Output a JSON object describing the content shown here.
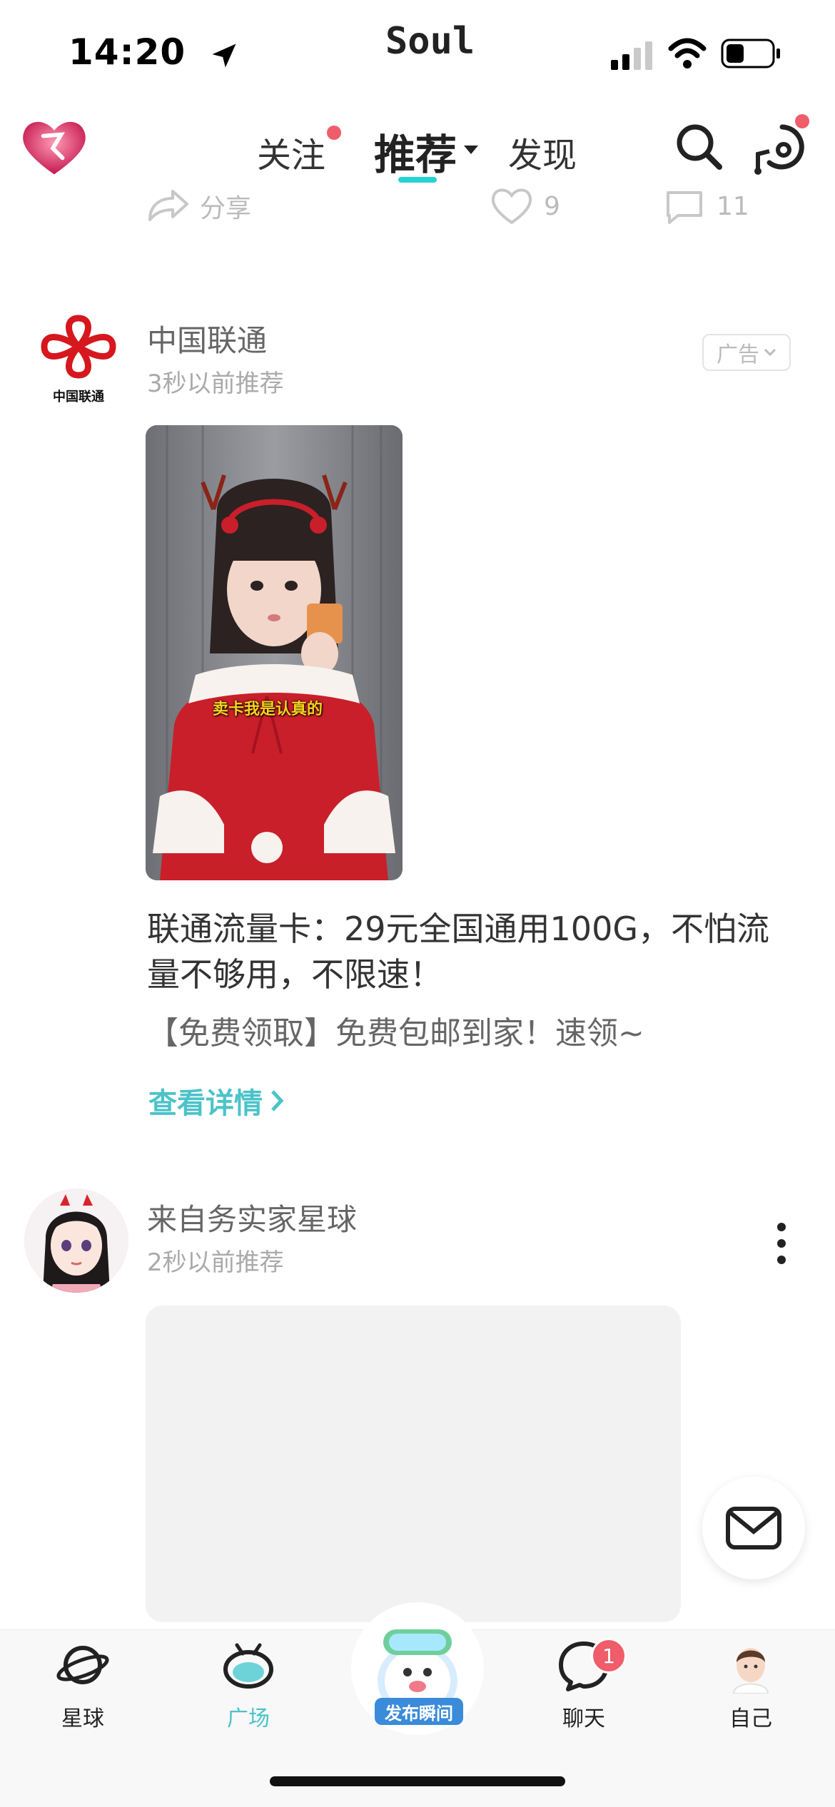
{
  "status_bar": {
    "time": "14:20",
    "app_name": "Soul",
    "battery_level": 0.4
  },
  "top_nav": {
    "tabs": [
      {
        "label": "关注",
        "has_dot": true
      },
      {
        "label": "推荐",
        "active": true
      },
      {
        "label": "发现"
      }
    ],
    "accent_color": "#25d4d0",
    "dot_color": "#ef5d6a",
    "icons": [
      "search-icon",
      "music-chat-icon"
    ]
  },
  "prev_post_actions": {
    "share_label": "分享",
    "like_count": "9",
    "comment_count": "11"
  },
  "ad_post": {
    "author": "中国联通",
    "logo_caption": "中国联通",
    "time": "3秒以前推荐",
    "badge": "广告",
    "image_caption": "卖卡我是认真的",
    "text": "联通流量卡：29元全国通用100G，不怕流量不够用，不限速！",
    "subtext": "【免费领取】免费包邮到家！速领~",
    "link": "查看详情"
  },
  "post2": {
    "author": "来自务实家星球",
    "time": "2秒以前推荐"
  },
  "bottom_tabs": {
    "items": [
      {
        "label": "星球"
      },
      {
        "label": "广场",
        "active": true
      },
      {
        "label": "发布瞬间"
      },
      {
        "label": "聊天",
        "badge": "1"
      },
      {
        "label": "自己"
      }
    ],
    "active_color": "#4bc3c9"
  }
}
